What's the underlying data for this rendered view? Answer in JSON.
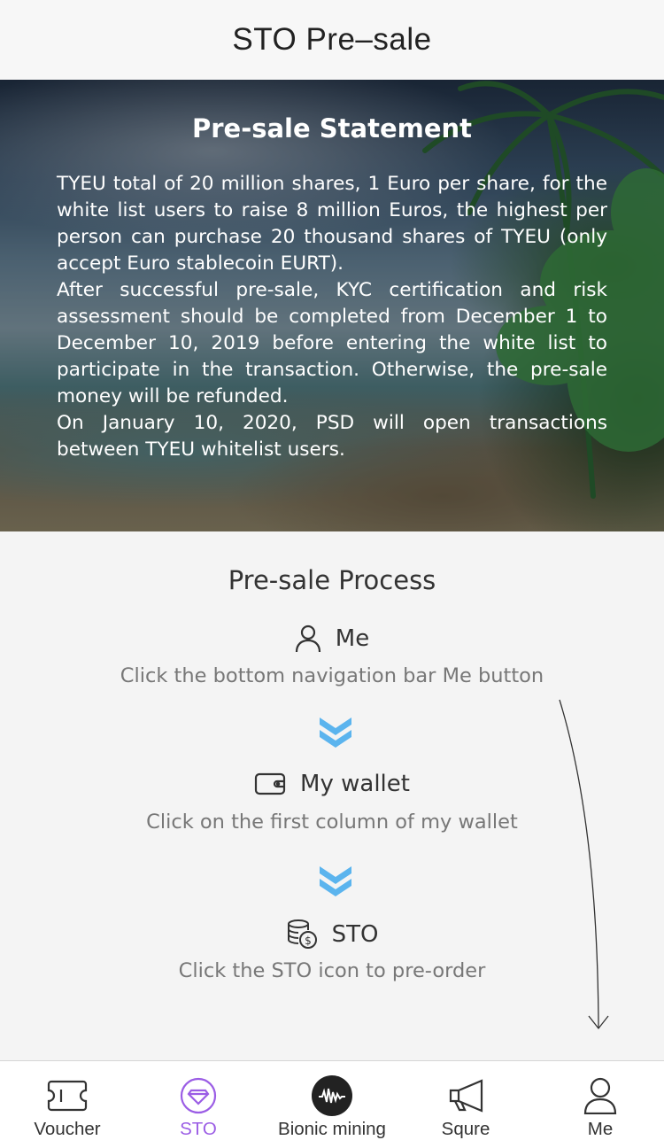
{
  "header": {
    "title": "STO Pre–sale"
  },
  "statement": {
    "title": "Pre-sale Statement",
    "paragraphs": [
      "TYEU total of 20 million shares, 1 Euro per share, for the white list users to raise 8 million Euros, the highest per person can purchase 20 thousand shares of TYEU (only accept Euro stablecoin EURT).",
      "After successful pre-sale, KYC certification and risk assessment should be completed from December 1 to December 10, 2019 before entering the white list to participate in the transaction. Otherwise, the pre-sale money will be refunded.",
      "On January 10, 2020, PSD will open transactions between TYEU whitelist users."
    ]
  },
  "process": {
    "title": "Pre-sale Process",
    "steps": [
      {
        "icon": "user-icon",
        "label": "Me",
        "desc": "Click the bottom navigation bar Me button"
      },
      {
        "icon": "wallet-icon",
        "label": "My wallet",
        "desc": "Click on the first column of my wallet"
      },
      {
        "icon": "coins-icon",
        "label": "STO",
        "desc": "Click the STO icon to pre-order"
      }
    ]
  },
  "tabbar": {
    "active_color": "#9b5de5",
    "items": [
      {
        "label": "Voucher",
        "icon": "ticket-icon"
      },
      {
        "label": "STO",
        "icon": "sto-diamond-icon",
        "active": true
      },
      {
        "label": "Bionic mining",
        "icon": "waveform-icon"
      },
      {
        "label": "Squre",
        "icon": "megaphone-icon"
      },
      {
        "label": "Me",
        "icon": "user-icon"
      }
    ]
  }
}
